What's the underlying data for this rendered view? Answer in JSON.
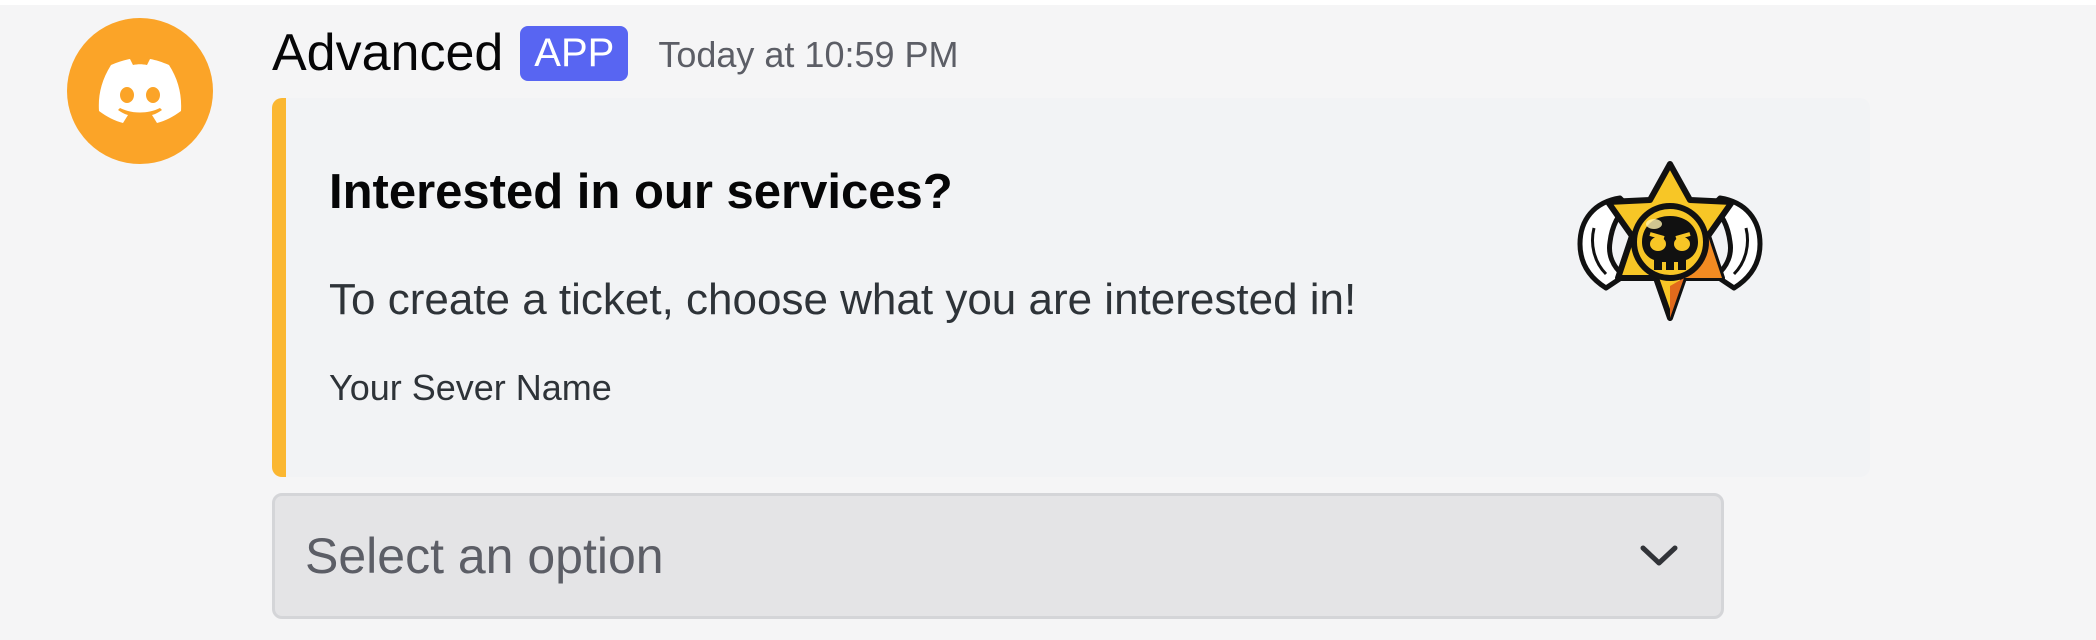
{
  "message": {
    "author": "Advanced",
    "badge": "APP",
    "timestamp": "Today at 10:59 PM",
    "avatar_icon": "discord-logo-icon",
    "avatar_color": "#fba428"
  },
  "embed": {
    "accent_color": "#fbb731",
    "title": "Interested in our services?",
    "description": "To create a ticket, choose what you are interested in!",
    "footer": "Your Sever Name",
    "thumbnail_icon": "star-skull-badge-icon"
  },
  "select_menu": {
    "placeholder": "Select an option",
    "icon": "chevron-down-icon"
  }
}
